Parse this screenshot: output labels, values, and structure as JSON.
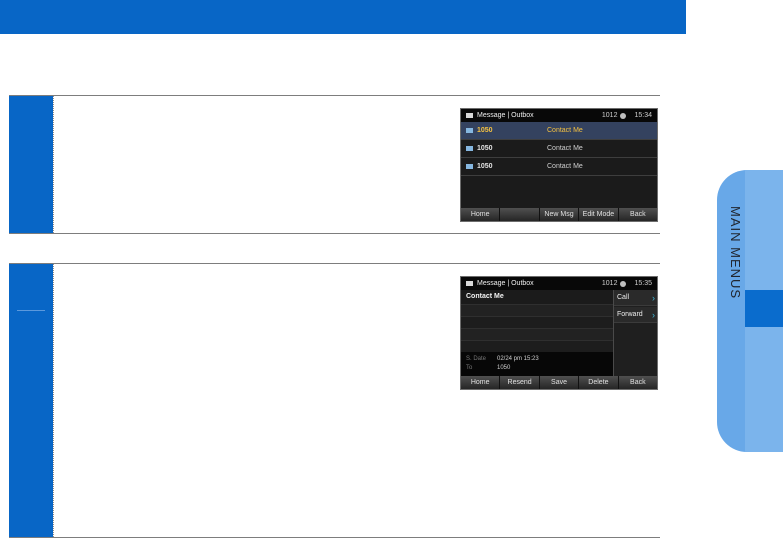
{
  "side_tab": {
    "label": "MAIN MENUS"
  },
  "screen_outbox_list": {
    "status": {
      "title": "Message | Outbox",
      "number": "1012",
      "time": "15:34"
    },
    "rows": [
      {
        "number": "1050",
        "text": "Contact Me",
        "selected": true
      },
      {
        "number": "1050",
        "text": "Contact Me",
        "selected": false
      },
      {
        "number": "1050",
        "text": "Contact Me",
        "selected": false
      }
    ],
    "softkeys": [
      "Home",
      "",
      "New Msg",
      "Edit Mode",
      "Back"
    ]
  },
  "screen_outbox_detail": {
    "status": {
      "title": "Message | Outbox",
      "number": "1012",
      "time": "15:35"
    },
    "message_title": "Contact Me",
    "sent_date_label": "S. Date",
    "sent_date_value": "02/24 pm 15:23",
    "to_label": "To",
    "to_value": "1050",
    "menu": [
      "Call",
      "Forward"
    ],
    "softkeys": [
      "Home",
      "Resend",
      "Save",
      "Delete",
      "Back"
    ]
  },
  "colors": {
    "accent": "#0866c6",
    "side_tab": "#68a8e8",
    "selected_row": "#34425f",
    "selected_text": "#f5c242"
  }
}
